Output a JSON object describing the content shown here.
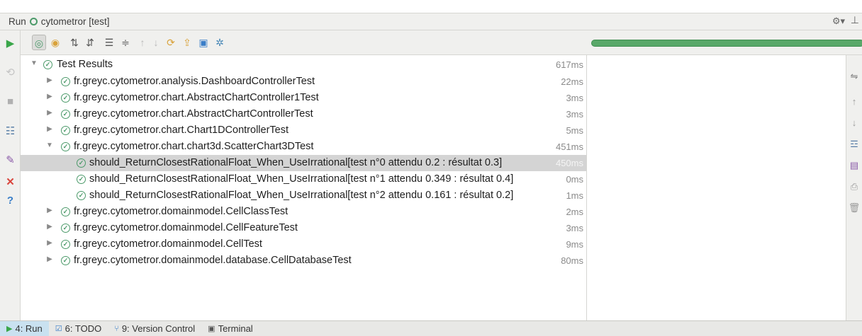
{
  "window": {
    "run_prefix": "Run",
    "config_name": "cytometror [test]",
    "gear_icon": "⚙▾",
    "pin_icon": "⊥"
  },
  "tree": {
    "rows": [
      {
        "label": "Test Results",
        "time": "617ms"
      },
      {
        "label": "fr.greyc.cytometror.analysis.DashboardControllerTest",
        "time": "22ms"
      },
      {
        "label": "fr.greyc.cytometror.chart.AbstractChartController1Test",
        "time": "3ms"
      },
      {
        "label": "fr.greyc.cytometror.chart.AbstractChartControllerTest",
        "time": "3ms"
      },
      {
        "label": "fr.greyc.cytometror.chart.Chart1DControllerTest",
        "time": "5ms"
      },
      {
        "label": "fr.greyc.cytometror.chart.chart3d.ScatterChart3DTest",
        "time": "451ms"
      },
      {
        "label": "should_ReturnClosestRationalFloat_When_UseIrrational[test n°0 attendu 0.2 : résultat 0.3]",
        "time": "450ms"
      },
      {
        "label": "should_ReturnClosestRationalFloat_When_UseIrrational[test n°1 attendu 0.349 : résultat 0.4]",
        "time": "0ms"
      },
      {
        "label": "should_ReturnClosestRationalFloat_When_UseIrrational[test n°2 attendu 0.161 : résultat 0.2]",
        "time": "1ms"
      },
      {
        "label": "fr.greyc.cytometror.domainmodel.CellClassTest",
        "time": "2ms"
      },
      {
        "label": "fr.greyc.cytometror.domainmodel.CellFeatureTest",
        "time": "3ms"
      },
      {
        "label": "fr.greyc.cytometror.domainmodel.CellTest",
        "time": "9ms"
      },
      {
        "label": "fr.greyc.cytometror.domainmodel.database.CellDatabaseTest",
        "time": "80ms"
      }
    ]
  },
  "progress": {
    "fraction": 1.0,
    "color": "#59a869"
  },
  "statusbar": {
    "run": "4: Run",
    "todo": "6: TODO",
    "vcs": "9: Version Control",
    "terminal": "Terminal"
  },
  "colors": {
    "pass": "#4c9a6a",
    "fail": "#d9453d",
    "selection": "#d4d4d4"
  }
}
